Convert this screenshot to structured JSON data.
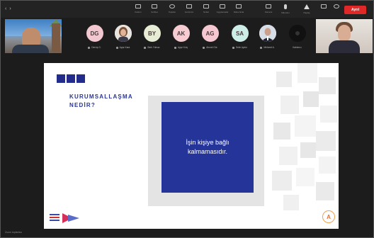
{
  "toolbar": {
    "title": "",
    "buttons": [
      {
        "label": "Katılım",
        "icon": "people-icon"
      },
      {
        "label": "Sohbet",
        "icon": "chat-icon"
      },
      {
        "label": "Tepkiler",
        "icon": "emoji-icon"
      },
      {
        "label": "Görünüm",
        "icon": "layout-icon"
      },
      {
        "label": "Notlar",
        "icon": "notes-icon"
      },
      {
        "label": "Uygulamalar",
        "icon": "apps-icon"
      },
      {
        "label": "Daha fazla",
        "icon": "more-icon"
      },
      {
        "label": "Kamera",
        "icon": "camera-icon"
      },
      {
        "label": "Mikrofon",
        "icon": "mic-icon"
      },
      {
        "label": "Paylaş",
        "icon": "share-icon"
      }
    ],
    "leave_label": "Ayrıl"
  },
  "participants": [
    {
      "initials": "DG",
      "name": "Derviş G.",
      "color": "#f3c7cf"
    },
    {
      "initials": "",
      "name": "Ayşe Kara",
      "color": "#e8d6cf",
      "photo": true
    },
    {
      "initials": "BY",
      "name": "Berk Yılmaz",
      "color": "#e7edd4"
    },
    {
      "initials": "AK",
      "name": "Ayşe Kılıç",
      "color": "#f6cbd2"
    },
    {
      "initials": "AG",
      "name": "Ahmet Gür",
      "color": "#f5c7d0"
    },
    {
      "initials": "SA",
      "name": "Selin Aydın",
      "color": "#cdeee6"
    },
    {
      "initials": "",
      "name": "Mehmet A.",
      "color": "#d7dde6",
      "photo": true
    },
    {
      "initials": "",
      "name": "Katılımcı",
      "color": "#101010",
      "photo": true
    }
  ],
  "slide": {
    "title_line1": "KURUMSALLAŞMA",
    "title_line2": "NEDİR?",
    "card_text": "İşin kişiye bağlı kalmamasıdır.",
    "corner_letter": "A"
  },
  "bottom_label": "Zoom toplantısı",
  "colors": {
    "accent_blue": "#253499",
    "leave_red": "#e02828",
    "background": "#1c1c1c"
  }
}
